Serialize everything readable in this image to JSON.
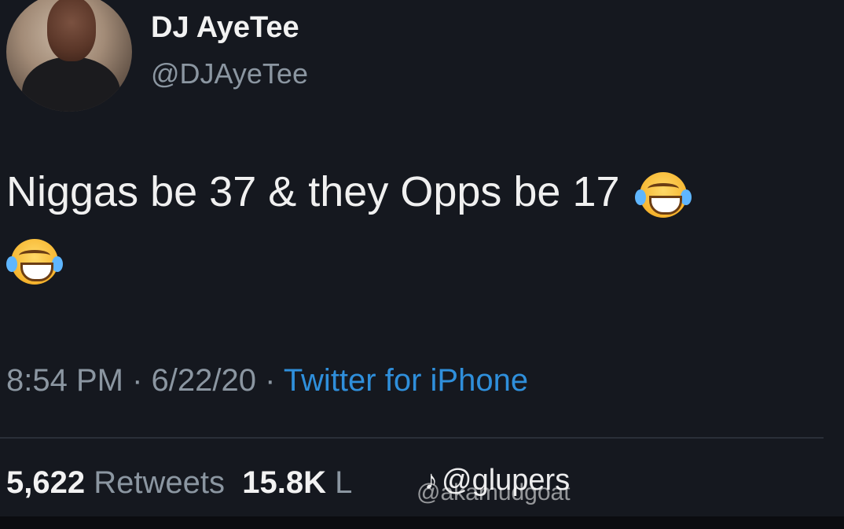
{
  "profile": {
    "display_name": "DJ AyeTee",
    "handle": "@DJAyeTee"
  },
  "tweet": {
    "text": "Niggas be 37 & they Opps be 17",
    "emoji": "face-with-tears-of-joy"
  },
  "meta": {
    "time": "8:54 PM",
    "sep1": " · ",
    "date": "6/22/20",
    "sep2": " · ",
    "source": "Twitter for iPhone"
  },
  "stats": {
    "retweets_count": "5,622",
    "retweets_label": "Retweets",
    "likes_count": "15.8K",
    "likes_label_partial": "L"
  },
  "watermarks": {
    "primary": "@glupers",
    "secondary": "@akamudgoat"
  },
  "colors": {
    "background": "#15181f",
    "link": "#2f8fdb",
    "secondary_text": "#8b96a1"
  }
}
